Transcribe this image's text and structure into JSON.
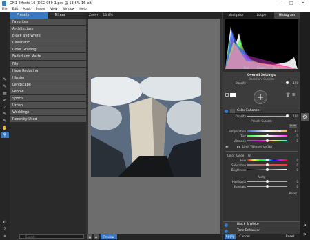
{
  "window": {
    "title": "ON1 Effects 10 (DSC-059-1.psd @ 13.6% 16-bit)",
    "minimize": "—",
    "maximize": "□",
    "close": "✕"
  },
  "menu": [
    "File",
    "Edit",
    "Mask",
    "Preset",
    "View",
    "Window",
    "Help"
  ],
  "browser": {
    "tabs": {
      "presets": "Presets",
      "filters": "Filters"
    },
    "categories": [
      "Favorites",
      "Architecture",
      "Black and White",
      "Cinematic",
      "Color Grading",
      "Faded and Matte",
      "Film",
      "Haze Reducing",
      "Hipster",
      "Landscape",
      "People",
      "Sports",
      "Urban",
      "Weddings",
      "Recently Used"
    ],
    "search_placeholder": "Search"
  },
  "center": {
    "zoom_label": "Zoom",
    "zoom_value": "13.6%",
    "preview_label": "Preview"
  },
  "right": {
    "tabs": {
      "navigator": "Navigator",
      "loupe": "Loupe",
      "histogram": "Histogram"
    },
    "histo_labels": [
      "Red",
      "Green",
      "Blue"
    ],
    "overall": {
      "title": "Overall Settings",
      "based_on": "Based on: Custom",
      "opacity_label": "Opacity",
      "opacity_value": "100"
    },
    "color_enhancer": {
      "title": "Color Enhancer",
      "opacity_label": "Opacity",
      "opacity_value": "100",
      "preset_label": "Preset: Custom",
      "auto_label": "Auto",
      "sliders": [
        {
          "label": "Temperature",
          "value": "83"
        },
        {
          "label": "Tint",
          "value": "0"
        },
        {
          "label": "Vibrance",
          "value": "0"
        }
      ],
      "limit_label": "Limit Vibrance on Skin",
      "color_range_label": "Color Range",
      "color_range_value": "All",
      "range_sliders": [
        {
          "label": "Hue",
          "value": "0"
        },
        {
          "label": "Saturation",
          "value": "0"
        },
        {
          "label": "Brightness",
          "value": "0"
        }
      ],
      "purity_label": "Purity",
      "purity_sliders": [
        {
          "label": "Highlights",
          "value": "0"
        },
        {
          "label": "Shadows",
          "value": "0"
        }
      ],
      "reset_label": "Reset"
    },
    "layers": [
      "Tone Enhancer",
      "Black & White"
    ],
    "buttons": {
      "apply": "Apply",
      "cancel": "Cancel",
      "reset": "Reset"
    }
  }
}
